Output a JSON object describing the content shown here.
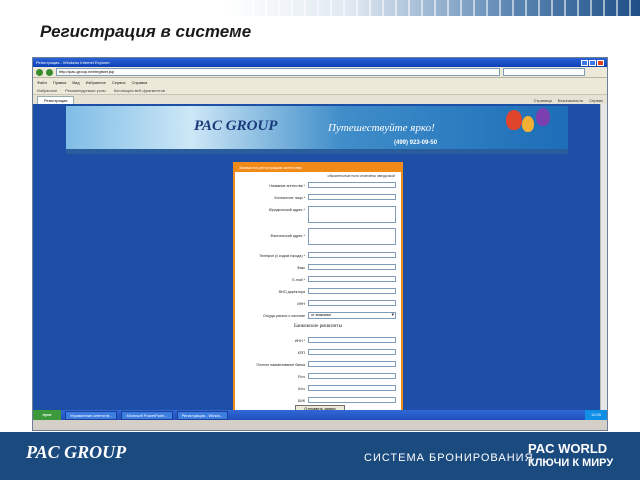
{
  "slide": {
    "title": "Регистрация в системе"
  },
  "browser": {
    "window_title": "Регистрация - Windows Internet Explorer",
    "address": "http://pac-group.net/register.jsp",
    "menu": [
      "Файл",
      "Правка",
      "Вид",
      "Избранное",
      "Сервис",
      "Справка"
    ],
    "favorites": [
      "Избранное",
      "Рекомендуемые узлы",
      "Коллекция веб-фрагментов"
    ],
    "tab_label": "Регистрация",
    "tools": [
      "Страница",
      "Безопасность",
      "Сервис"
    ]
  },
  "banner": {
    "logo": "PAC GROUP",
    "slogan": "Путешествуйте ярко!",
    "phone": "(499) 923-09-50"
  },
  "form": {
    "header": "Заявка на регистрацию агентства",
    "required_note": "обязательные поля отмечены звездочкой",
    "fields": [
      {
        "label": "Название агентства *",
        "kind": "input"
      },
      {
        "label": "Контактное лицо *",
        "kind": "input"
      },
      {
        "label": "Юридический адрес *",
        "kind": "textarea"
      },
      {
        "label": "Фактический адрес *",
        "kind": "textarea"
      },
      {
        "label": "Телефон (с кодом города) *",
        "kind": "input"
      },
      {
        "label": "Факс",
        "kind": "input"
      },
      {
        "label": "E-mail *",
        "kind": "input"
      },
      {
        "label": "ФИО директора",
        "kind": "input"
      },
      {
        "label": "ИНН",
        "kind": "input"
      },
      {
        "label": "Откуда узнали о системе",
        "kind": "select",
        "value": "от знакомых"
      }
    ],
    "bank_header": "Банковские реквизиты",
    "bank_fields": [
      {
        "label": "ИНН *"
      },
      {
        "label": "КПП"
      },
      {
        "label": "Полное наименование банка"
      },
      {
        "label": "Р/сч"
      },
      {
        "label": "К/сч"
      },
      {
        "label": "БИК"
      }
    ],
    "submit_label": "Отправить заявку"
  },
  "taskbar": {
    "start": "пуск",
    "items": [
      "Управление агентств...",
      "Microsoft PowerPoint...",
      "Регистрация - Windo..."
    ],
    "clock": "12:00"
  },
  "footer": {
    "logo": "PAC GROUP",
    "system": "СИСТЕМА БРОНИРОВАНИЯ",
    "pw_line1": "PAC WORLD",
    "pw_line2": "КЛЮЧИ К МИРУ"
  }
}
